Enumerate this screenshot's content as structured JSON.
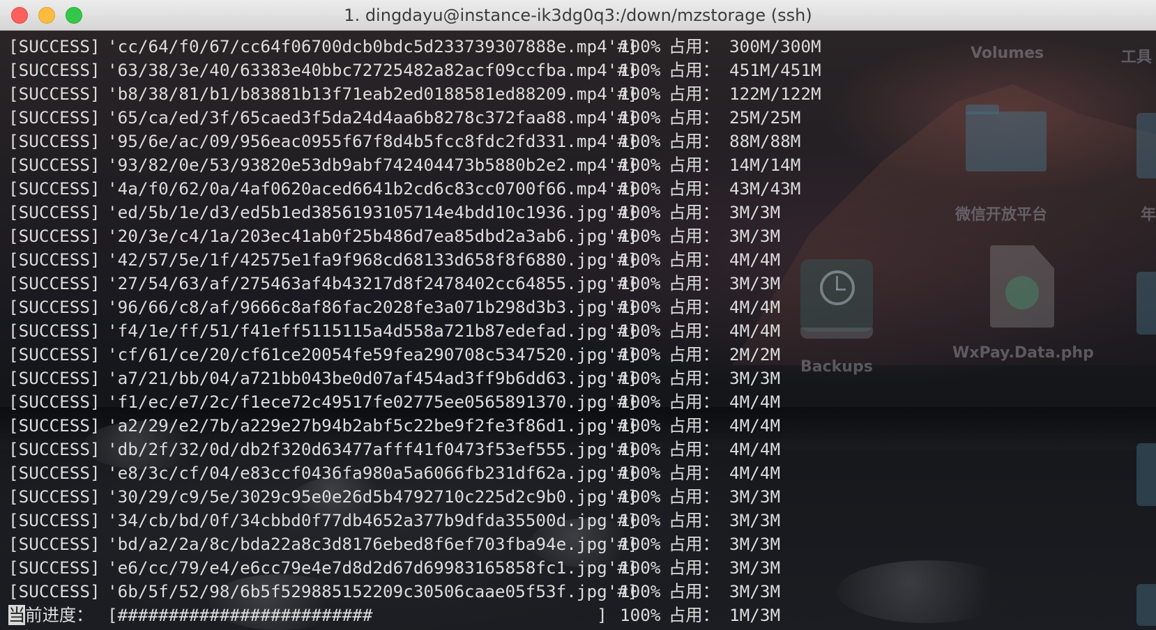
{
  "window": {
    "title": "1. dingdayu@instance-ik3dg0q3:/down/mzstorage (ssh)"
  },
  "desktop": {
    "items": [
      {
        "label": "Volumes",
        "icon": "volume-icon"
      },
      {
        "label": "工具",
        "icon": "folder-icon"
      },
      {
        "label": "微信开放平台",
        "icon": "folder-icon"
      },
      {
        "label": "年",
        "icon": "folder-icon"
      },
      {
        "label": "Backups",
        "icon": "time-machine-icon"
      },
      {
        "label": "WxPay.Data.php",
        "icon": "php-file-icon"
      }
    ]
  },
  "terminal": {
    "lines": [
      {
        "status": "[SUCCESS]",
        "path": "'cc/64/f0/67/cc64f06700dcb0bdc5d233739307888e.mp4'#]",
        "percent": "100%",
        "label": "占用：",
        "size": "300M/300M"
      },
      {
        "status": "[SUCCESS]",
        "path": "'63/38/3e/40/63383e40bbc72725482a82acf09ccfba.mp4'#]",
        "percent": "100%",
        "label": "占用：",
        "size": "451M/451M"
      },
      {
        "status": "[SUCCESS]",
        "path": "'b8/38/81/b1/b83881b13f71eab2ed0188581ed88209.mp4'#]",
        "percent": "100%",
        "label": "占用：",
        "size": "122M/122M"
      },
      {
        "status": "[SUCCESS]",
        "path": "'65/ca/ed/3f/65caed3f5da24d4aa6b8278c372faa88.mp4'#]",
        "percent": "100%",
        "label": "占用：",
        "size": "25M/25M"
      },
      {
        "status": "[SUCCESS]",
        "path": "'95/6e/ac/09/956eac0955f67f8d4b5fcc8fdc2fd331.mp4'#]",
        "percent": "100%",
        "label": "占用：",
        "size": "88M/88M"
      },
      {
        "status": "[SUCCESS]",
        "path": "'93/82/0e/53/93820e53db9abf742404473b5880b2e2.mp4'#]",
        "percent": "100%",
        "label": "占用：",
        "size": "14M/14M"
      },
      {
        "status": "[SUCCESS]",
        "path": "'4a/f0/62/0a/4af0620aced6641b2cd6c83cc0700f66.mp4'#]",
        "percent": "100%",
        "label": "占用：",
        "size": "43M/43M"
      },
      {
        "status": "[SUCCESS]",
        "path": "'ed/5b/1e/d3/ed5b1ed3856193105714e4bdd10c1936.jpg'#]",
        "percent": "100%",
        "label": "占用：",
        "size": "3M/3M"
      },
      {
        "status": "[SUCCESS]",
        "path": "'20/3e/c4/1a/203ec41ab0f25b486d7ea85dbd2a3ab6.jpg'#]",
        "percent": "100%",
        "label": "占用：",
        "size": "3M/3M"
      },
      {
        "status": "[SUCCESS]",
        "path": "'42/57/5e/1f/42575e1fa9f968cd68133d658f8f6880.jpg'#]",
        "percent": "100%",
        "label": "占用：",
        "size": "4M/4M"
      },
      {
        "status": "[SUCCESS]",
        "path": "'27/54/63/af/275463af4b43217d8f2478402cc64855.jpg'#]",
        "percent": "100%",
        "label": "占用：",
        "size": "3M/3M"
      },
      {
        "status": "[SUCCESS]",
        "path": "'96/66/c8/af/9666c8af86fac2028fe3a071b298d3b3.jpg'#]",
        "percent": "100%",
        "label": "占用：",
        "size": "4M/4M"
      },
      {
        "status": "[SUCCESS]",
        "path": "'f4/1e/ff/51/f41eff5115115a4d558a721b87edefad.jpg'#]",
        "percent": "100%",
        "label": "占用：",
        "size": "4M/4M"
      },
      {
        "status": "[SUCCESS]",
        "path": "'cf/61/ce/20/cf61ce20054fe59fea290708c5347520.jpg'#]",
        "percent": "100%",
        "label": "占用：",
        "size": "2M/2M"
      },
      {
        "status": "[SUCCESS]",
        "path": "'a7/21/bb/04/a721bb043be0d07af454ad3ff9b6dd63.jpg'#]",
        "percent": "100%",
        "label": "占用：",
        "size": "3M/3M"
      },
      {
        "status": "[SUCCESS]",
        "path": "'f1/ec/e7/2c/f1ece72c49517fe02775ee0565891370.jpg'#]",
        "percent": "100%",
        "label": "占用：",
        "size": "4M/4M"
      },
      {
        "status": "[SUCCESS]",
        "path": "'a2/29/e2/7b/a229e27b94b2abf5c22be9f2fe3f86d1.jpg'#]",
        "percent": "100%",
        "label": "占用：",
        "size": "4M/4M"
      },
      {
        "status": "[SUCCESS]",
        "path": "'db/2f/32/0d/db2f320d63477afff41f0473f53ef555.jpg'#]",
        "percent": "100%",
        "label": "占用：",
        "size": "4M/4M"
      },
      {
        "status": "[SUCCESS]",
        "path": "'e8/3c/cf/04/e83ccf0436fa980a5a6066fb231df62a.jpg'#]",
        "percent": "100%",
        "label": "占用：",
        "size": "4M/4M"
      },
      {
        "status": "[SUCCESS]",
        "path": "'30/29/c9/5e/3029c95e0e26d5b4792710c225d2c9b0.jpg'#]",
        "percent": "100%",
        "label": "占用：",
        "size": "3M/3M"
      },
      {
        "status": "[SUCCESS]",
        "path": "'34/cb/bd/0f/34cbbd0f77db4652a377b9dfda35500d.jpg'#]",
        "percent": "100%",
        "label": "占用：",
        "size": "3M/3M"
      },
      {
        "status": "[SUCCESS]",
        "path": "'bd/a2/2a/8c/bda22a8c3d8176ebed8f6ef703fba94e.jpg'#]",
        "percent": "100%",
        "label": "占用：",
        "size": "3M/3M"
      },
      {
        "status": "[SUCCESS]",
        "path": "'e6/cc/79/e4/e6cc79e4e7d8d2d67d69983165858fc1.jpg'#]",
        "percent": "100%",
        "label": "占用：",
        "size": "3M/3M"
      },
      {
        "status": "[SUCCESS]",
        "path": "'6b/5f/52/98/6b5f529885152209c30506caae05f53f.jpg'#]",
        "percent": "100%",
        "label": "占用：",
        "size": "3M/3M"
      }
    ],
    "progress": {
      "cursor_char": "当",
      "label_rest": "前进度：",
      "bar": "[#########################                      ]",
      "percent": "100%",
      "label": "占用：",
      "size": "1M/3M"
    }
  }
}
